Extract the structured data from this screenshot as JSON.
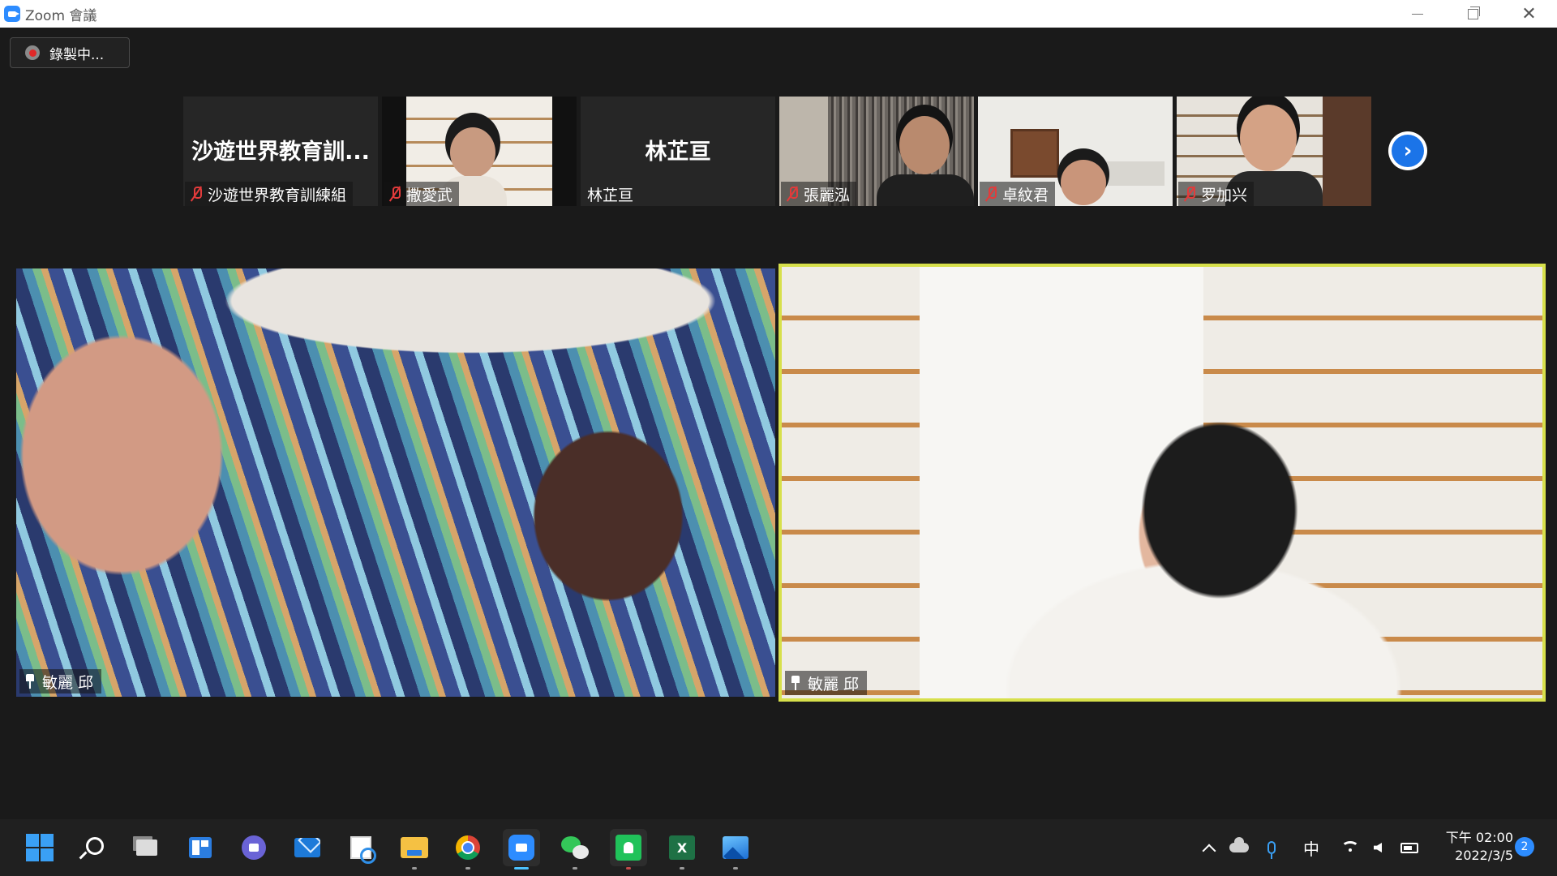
{
  "window": {
    "title": "Zoom 會議",
    "minimize_icon": "minimize-icon",
    "restore_icon": "restore-icon",
    "close_icon": "close-icon"
  },
  "recording": {
    "label": "錄製中...",
    "icon": "record-icon"
  },
  "gallery": [
    {
      "big_name": "沙遊世界教育訓...",
      "name": "沙遊世界教育訓練組",
      "muted": true,
      "has_video": false
    },
    {
      "big_name": "",
      "name": "撒愛武",
      "muted": true,
      "has_video": true
    },
    {
      "big_name": "林芷亘",
      "name": "林芷亘",
      "muted": false,
      "has_video": false
    },
    {
      "big_name": "",
      "name": "張麗泓",
      "muted": true,
      "has_video": true
    },
    {
      "big_name": "",
      "name": "卓紋君",
      "muted": true,
      "has_video": true
    },
    {
      "big_name": "",
      "name": "罗加兴",
      "muted": true,
      "has_video": true
    }
  ],
  "next_page_icon": "chevron-right-icon",
  "main_videos": [
    {
      "name": "敏麗 邱",
      "pinned": true,
      "active_speaker": false
    },
    {
      "name": "敏麗 邱",
      "pinned": true,
      "active_speaker": true,
      "highlight_color": "#d7e04b"
    }
  ],
  "taskbar": {
    "apps": [
      "start",
      "search",
      "task-view",
      "widgets",
      "teams-chat",
      "mail",
      "snipping-tool",
      "file-explorer",
      "chrome",
      "zoom",
      "wechat",
      "line",
      "excel",
      "photos"
    ],
    "excel_glyph": "X",
    "ime": "中",
    "time": "下午 02:00",
    "date": "2022/3/5",
    "notifications": "2"
  },
  "colors": {
    "background": "#1a1a1a",
    "active_speaker_border": "#d7e04b",
    "muted_red": "#e23b3b",
    "zoom_blue": "#2d8cff"
  }
}
